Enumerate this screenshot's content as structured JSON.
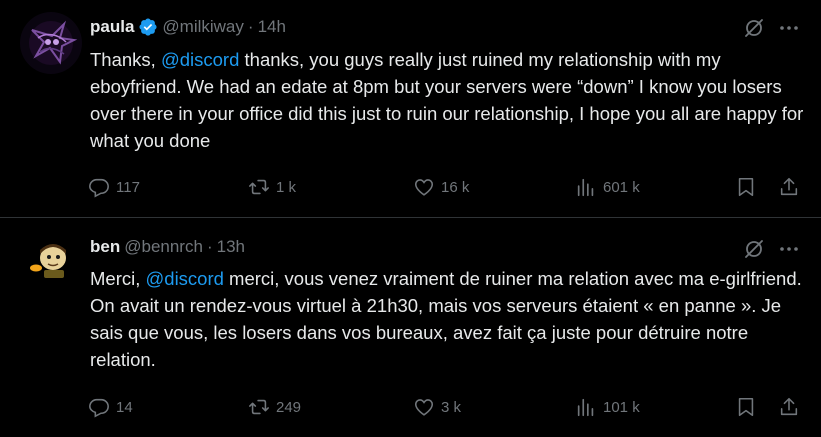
{
  "tweets": [
    {
      "author_name": "paula",
      "author_handle": "@milkiway",
      "separator": "·",
      "time": "14h",
      "verified": true,
      "text_before": "Thanks, ",
      "mention": "@discord",
      "text_after": " thanks, you guys really just ruined my relationship with my eboyfriend. We had an edate at 8pm but your servers were “down” I know you losers over there in your office did this just to ruin our relationship, I hope you all are happy for what you done",
      "replies": "117",
      "reposts": "1 k",
      "likes": "16 k",
      "views": "601 k"
    },
    {
      "author_name": "ben",
      "author_handle": "@bennrch",
      "separator": "·",
      "time": "13h",
      "verified": false,
      "text_before": "Merci, ",
      "mention": "@discord",
      "text_after": " merci, vous venez vraiment de ruiner ma relation avec ma e-girlfriend. On avait un rendez-vous virtuel à 21h30, mais vos serveurs étaient « en panne ». Je sais que vous, les losers dans vos bureaux, avez fait ça juste pour détruire notre relation.",
      "replies": "14",
      "reposts": "249",
      "likes": "3 k",
      "views": "101 k"
    }
  ],
  "icons": {
    "reply": "reply-icon",
    "repost": "repost-icon",
    "like": "like-icon",
    "views": "views-icon",
    "bookmark": "bookmark-icon",
    "share": "share-icon",
    "grok": "grok-icon",
    "more": "more-icon",
    "verified": "verified-badge-icon"
  },
  "colors": {
    "background": "#000000",
    "text": "#e7e9ea",
    "muted": "#71767b",
    "accent": "#1d9bf0",
    "divider": "#2f3336"
  }
}
